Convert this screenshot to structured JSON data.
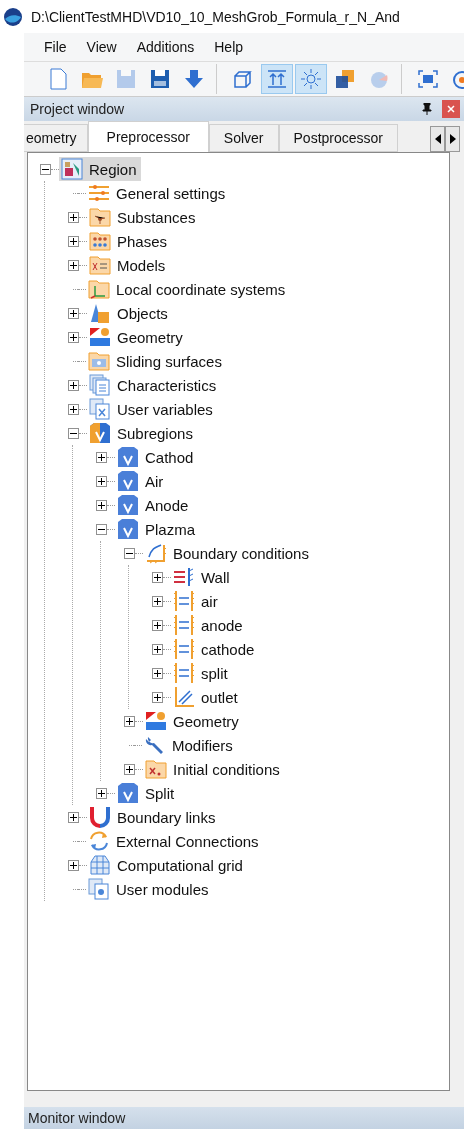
{
  "window": {
    "title": "D:\\ClientTestMHD\\VD10_10_MeshGrob_Formula_r_N_And"
  },
  "menu": [
    "File",
    "View",
    "Additions",
    "Help"
  ],
  "toolbar": [
    [
      {
        "kind": "new",
        "pressed": false,
        "disabled": false
      },
      {
        "kind": "open",
        "pressed": false,
        "disabled": false
      },
      {
        "kind": "save",
        "pressed": false,
        "disabled": true
      },
      {
        "kind": "saveas",
        "pressed": false,
        "disabled": false
      },
      {
        "kind": "down",
        "pressed": false,
        "disabled": false
      }
    ],
    [
      {
        "kind": "cube",
        "pressed": false,
        "disabled": false
      },
      {
        "kind": "align",
        "pressed": true,
        "disabled": false
      },
      {
        "kind": "light",
        "pressed": true,
        "disabled": false
      },
      {
        "kind": "layers",
        "pressed": false,
        "disabled": false
      },
      {
        "kind": "chart",
        "pressed": false,
        "disabled": true
      }
    ],
    [
      {
        "kind": "fit",
        "pressed": false,
        "disabled": false
      },
      {
        "kind": "target",
        "pressed": false,
        "disabled": false
      }
    ]
  ],
  "project_window": {
    "title": "Project window",
    "tabs": [
      {
        "label": "eometry",
        "selected": false
      },
      {
        "label": "Preprocessor",
        "selected": true
      },
      {
        "label": "Solver",
        "selected": false
      },
      {
        "label": "Postprocessor",
        "selected": false
      }
    ],
    "tree": [
      {
        "label": "Region",
        "kind": "region",
        "expanded": true,
        "selected": true,
        "children": [
          {
            "label": "General settings",
            "kind": "settings",
            "selected": false
          },
          {
            "label": "Substances",
            "kind": "substances",
            "expanded": false,
            "selected": false
          },
          {
            "label": "Phases",
            "kind": "phases",
            "expanded": false,
            "selected": false
          },
          {
            "label": "Models",
            "kind": "models",
            "expanded": false,
            "selected": false
          },
          {
            "label": "Local coordinate systems",
            "kind": "coords",
            "selected": false
          },
          {
            "label": "Objects",
            "kind": "objects",
            "expanded": false,
            "selected": false
          },
          {
            "label": "Geometry",
            "kind": "geometry",
            "expanded": false,
            "selected": false
          },
          {
            "label": "Sliding surfaces",
            "kind": "sliding",
            "selected": false
          },
          {
            "label": "Characteristics",
            "kind": "characteristics",
            "expanded": false,
            "selected": false
          },
          {
            "label": "User variables",
            "kind": "variables",
            "expanded": false,
            "selected": false
          },
          {
            "label": "Subregions",
            "kind": "subregions",
            "expanded": true,
            "selected": false,
            "children": [
              {
                "label": "Cathod",
                "kind": "subregion",
                "expanded": false,
                "selected": false
              },
              {
                "label": "Air",
                "kind": "subregion",
                "expanded": false,
                "selected": false
              },
              {
                "label": "Anode",
                "kind": "subregion",
                "expanded": false,
                "selected": false
              },
              {
                "label": "Plazma",
                "kind": "subregion",
                "expanded": true,
                "selected": false,
                "children": [
                  {
                    "label": "Boundary conditions",
                    "kind": "boundaries",
                    "expanded": true,
                    "selected": false,
                    "children": [
                      {
                        "label": "Wall",
                        "kind": "wall",
                        "expanded": false,
                        "selected": false
                      },
                      {
                        "label": "air",
                        "kind": "boundary",
                        "expanded": false,
                        "selected": false
                      },
                      {
                        "label": "anode",
                        "kind": "boundary",
                        "expanded": false,
                        "selected": false
                      },
                      {
                        "label": "cathode",
                        "kind": "boundary",
                        "expanded": false,
                        "selected": false
                      },
                      {
                        "label": "split",
                        "kind": "boundary",
                        "expanded": false,
                        "selected": false
                      },
                      {
                        "label": "outlet",
                        "kind": "outlet",
                        "expanded": false,
                        "selected": false
                      }
                    ]
                  },
                  {
                    "label": "Geometry",
                    "kind": "geometry",
                    "expanded": false,
                    "selected": false
                  },
                  {
                    "label": "Modifiers",
                    "kind": "modifiers",
                    "selected": false
                  },
                  {
                    "label": "Initial conditions",
                    "kind": "initial",
                    "expanded": false,
                    "selected": false
                  }
                ]
              },
              {
                "label": "Split",
                "kind": "subregion",
                "expanded": false,
                "selected": false
              }
            ]
          },
          {
            "label": "Boundary links",
            "kind": "links",
            "expanded": false,
            "selected": false
          },
          {
            "label": "External Connections",
            "kind": "connections",
            "selected": false
          },
          {
            "label": "Computational grid",
            "kind": "grid",
            "expanded": false,
            "selected": false
          },
          {
            "label": "User modules",
            "kind": "modules",
            "selected": false
          }
        ]
      }
    ]
  },
  "monitor_window": {
    "title": "Monitor window"
  }
}
